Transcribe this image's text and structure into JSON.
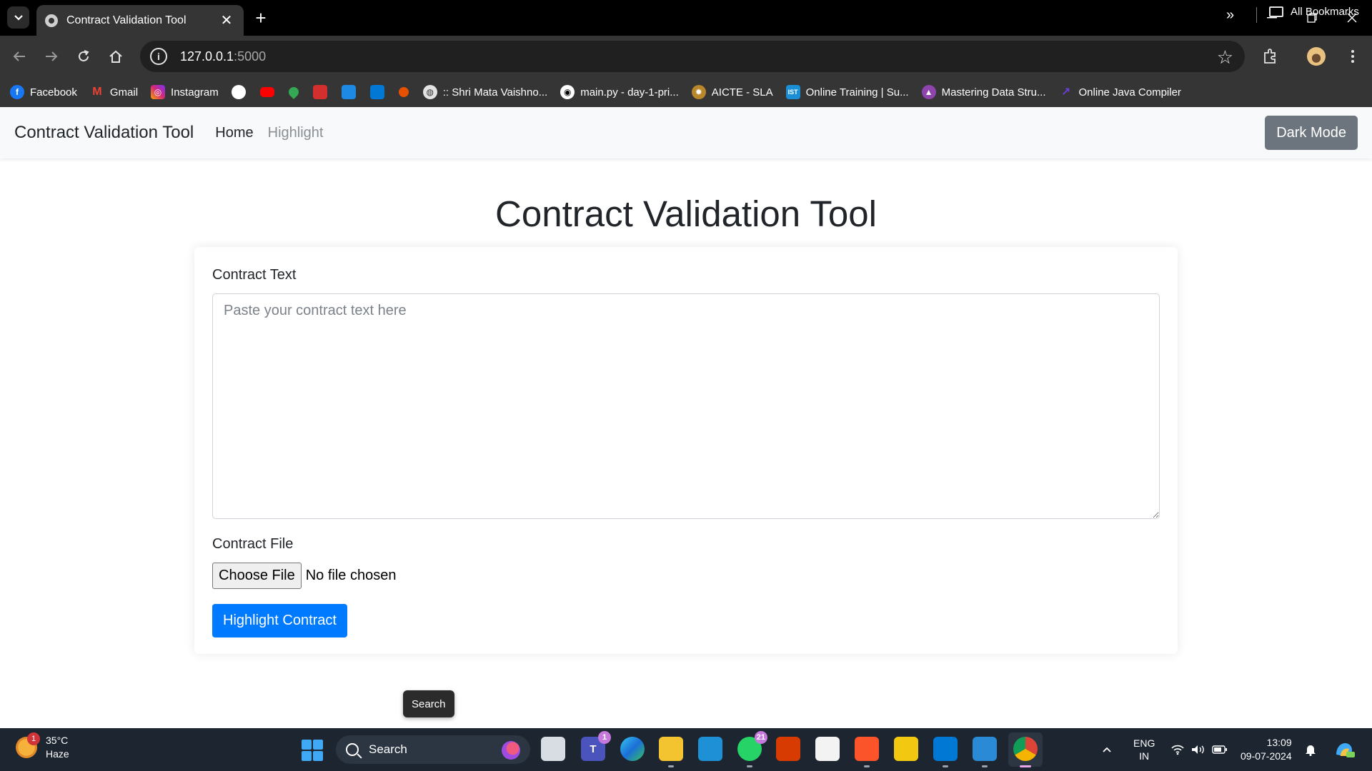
{
  "browser": {
    "tab_title": "Contract Validation Tool",
    "tab_close": "✕",
    "new_tab": "+",
    "url_host": "127.0.0.1",
    "url_port": ":5000",
    "bookmarks": [
      {
        "label": "Facebook",
        "icon": "facebook-icon",
        "color": "#1877f2",
        "glyph": "f"
      },
      {
        "label": "Gmail",
        "icon": "gmail-icon",
        "color": "#ea4335",
        "glyph": "M"
      },
      {
        "label": "Instagram",
        "icon": "instagram-icon",
        "color": "#d62976",
        "glyph": "◎"
      }
    ],
    "bookmarks_b": [
      {
        "label": ":: Shri Mata Vaishno...",
        "icon": "globe-icon",
        "color": "#5f6368",
        "glyph": "◍"
      },
      {
        "label": "main.py - day-1-pri...",
        "icon": "replit-icon",
        "color": "#000000",
        "glyph": "◉"
      },
      {
        "label": "AICTE - SLA",
        "icon": "aicte-icon",
        "color": "#b8862b",
        "glyph": "✹"
      },
      {
        "label": "Online Training | Su...",
        "icon": "ist-icon",
        "color": "#1a8fd6",
        "glyph": "IST"
      },
      {
        "label": "Mastering Data Stru...",
        "icon": "course-icon",
        "color": "#8e44ad",
        "glyph": "▲"
      },
      {
        "label": "Online Java Compiler",
        "icon": "java-compiler-icon",
        "color": "#6a3fd8",
        "glyph": "↗"
      }
    ],
    "all_bookmarks": "All Bookmarks"
  },
  "navbar": {
    "brand": "Contract Validation Tool",
    "home": "Home",
    "highlight": "Highlight",
    "dark_mode": "Dark Mode"
  },
  "main": {
    "title": "Contract Validation Tool",
    "contract_text_label": "Contract Text",
    "contract_text_placeholder": "Paste your contract text here",
    "contract_file_label": "Contract File",
    "choose_file": "Choose File",
    "file_status": "No file chosen",
    "submit": "Highlight Contract"
  },
  "tooltip": "Search",
  "taskbar": {
    "weather_temp": "35°C",
    "weather_desc": "Haze",
    "weather_badge": "1",
    "search_label": "Search",
    "teams_badge": "1",
    "whatsapp_badge": "21",
    "lang_line1": "ENG",
    "lang_line2": "IN",
    "time": "13:09",
    "date": "09-07-2024"
  },
  "colors": {
    "primary": "#007bff",
    "secondary": "#6c757d",
    "navbar_bg": "#f8f9fa"
  }
}
